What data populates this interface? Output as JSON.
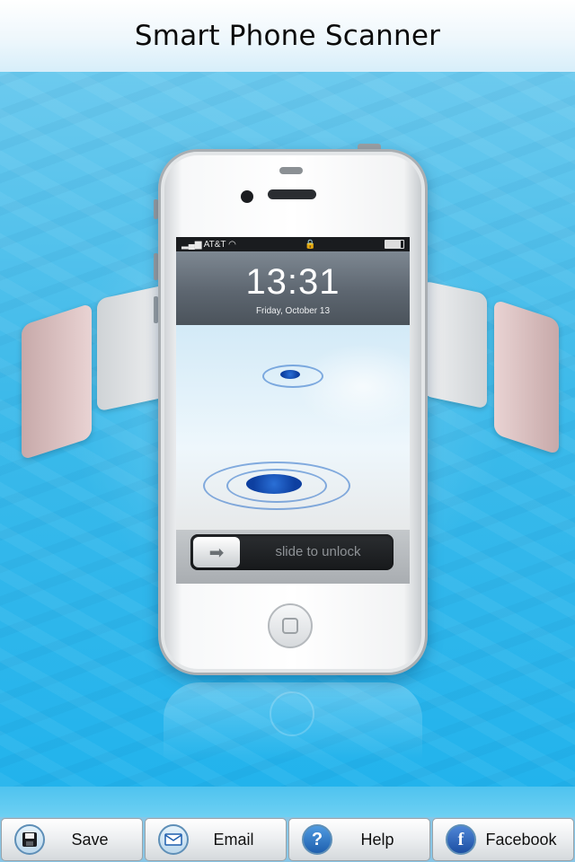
{
  "header": {
    "title": "Smart Phone Scanner"
  },
  "phone_screen": {
    "carrier": "AT&T",
    "lock_time": "13:31",
    "lock_date": "Friday, October 13",
    "unlock_hint": "slide to unlock"
  },
  "toolbar": {
    "buttons": [
      {
        "label": "Save",
        "icon": "save-icon"
      },
      {
        "label": "Email",
        "icon": "email-icon"
      },
      {
        "label": "Help",
        "icon": "help-icon"
      },
      {
        "label": "Facebook",
        "icon": "facebook-icon"
      }
    ]
  },
  "colors": {
    "background_blue": "#2fb8ea",
    "icon_blue": "#1e5fae",
    "header_bg": "#ffffff"
  }
}
